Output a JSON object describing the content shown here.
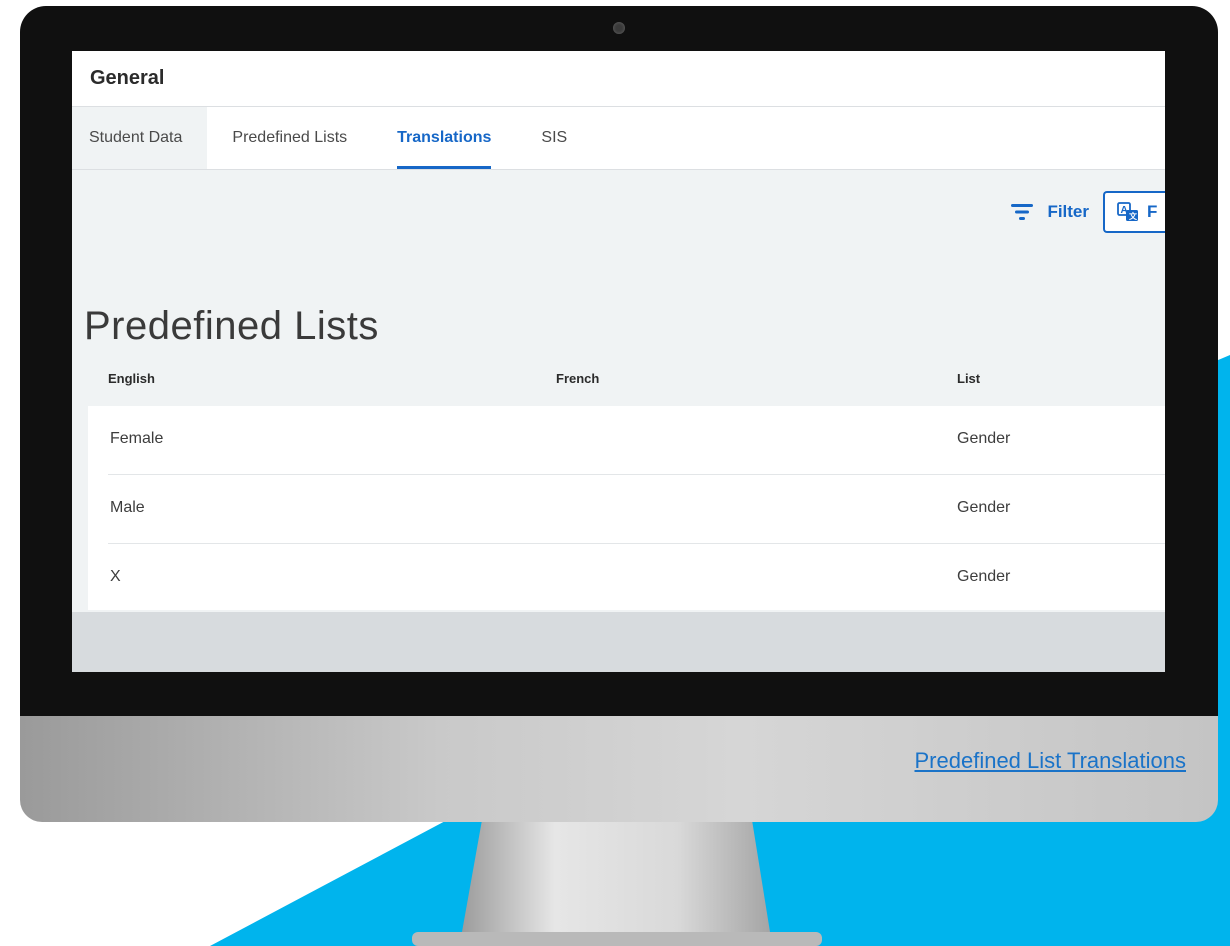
{
  "app": {
    "title": "General"
  },
  "tabs": [
    {
      "label": "Student Data"
    },
    {
      "label": "Predefined Lists"
    },
    {
      "label": "Translations",
      "active": true
    },
    {
      "label": "SIS"
    }
  ],
  "toolbar": {
    "filter_label": "Filter",
    "translate_label": "F"
  },
  "page": {
    "heading": "Predefined Lists"
  },
  "table": {
    "columns": [
      "English",
      "French",
      "List"
    ],
    "rows": [
      {
        "english": "Female",
        "french": "",
        "list": "Gender"
      },
      {
        "english": "Male",
        "french": "",
        "list": "Gender"
      },
      {
        "english": "X",
        "french": "",
        "list": "Gender"
      }
    ]
  },
  "caption": {
    "link_text": "Predefined List Translations"
  },
  "colors": {
    "accent": "#1667c7",
    "background_shape": "#00b4ed",
    "link": "#1a73c8"
  },
  "icons": {
    "filter": "filter-icon",
    "translate": "translate-icon"
  }
}
